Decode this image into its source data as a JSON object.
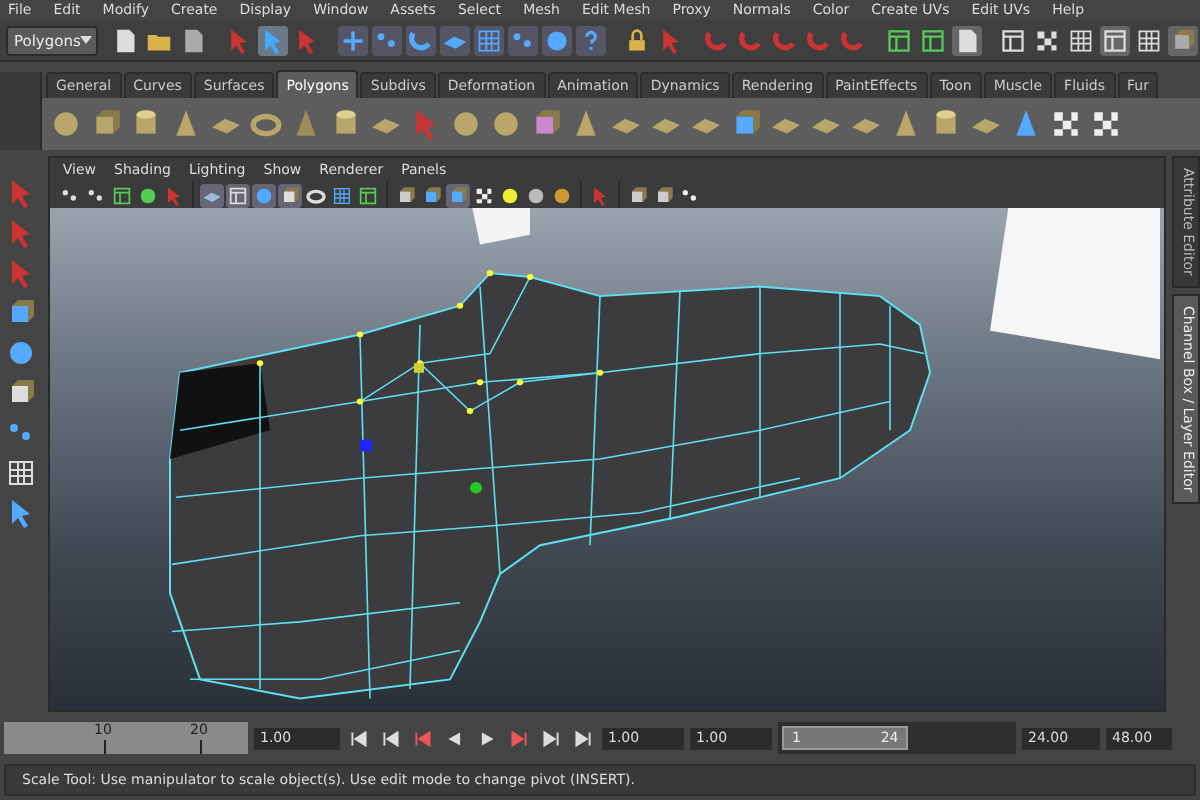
{
  "menu_bar": [
    "File",
    "Edit",
    "Modify",
    "Create",
    "Display",
    "Window",
    "Assets",
    "Select",
    "Mesh",
    "Edit Mesh",
    "Proxy",
    "Normals",
    "Color",
    "Create UVs",
    "Edit UVs",
    "Help"
  ],
  "status_line": {
    "mode_dropdown": "Polygons"
  },
  "shelf": {
    "tabs": [
      {
        "label": "General",
        "selected": false
      },
      {
        "label": "Curves",
        "selected": false
      },
      {
        "label": "Surfaces",
        "selected": false
      },
      {
        "label": "Polygons",
        "selected": true
      },
      {
        "label": "Subdivs",
        "selected": false
      },
      {
        "label": "Deformation",
        "selected": false
      },
      {
        "label": "Animation",
        "selected": false
      },
      {
        "label": "Dynamics",
        "selected": false
      },
      {
        "label": "Rendering",
        "selected": false
      },
      {
        "label": "PaintEffects",
        "selected": false
      },
      {
        "label": "Toon",
        "selected": false
      },
      {
        "label": "Muscle",
        "selected": false
      },
      {
        "label": "Fluids",
        "selected": false
      },
      {
        "label": "Fur",
        "selected": false
      }
    ]
  },
  "viewport": {
    "menu": [
      "View",
      "Shading",
      "Lighting",
      "Show",
      "Renderer",
      "Panels"
    ]
  },
  "side_tabs": [
    {
      "label": "Attribute Editor",
      "selected": false
    },
    {
      "label": "Channel Box / Layer Editor",
      "selected": true
    }
  ],
  "time_slider": {
    "ticks": [
      "10",
      "20"
    ],
    "current_time": "1.00"
  },
  "range_slider": {
    "level": 0.55,
    "start_time": "1.00",
    "playback_start": "1.00",
    "range_start": "1",
    "range_end": "24",
    "playback_end": "24.00",
    "end_time": "48.00"
  },
  "help_line": "Scale Tool: Use manipulator to scale object(s). Use edit mode to change pivot (INSERT)."
}
